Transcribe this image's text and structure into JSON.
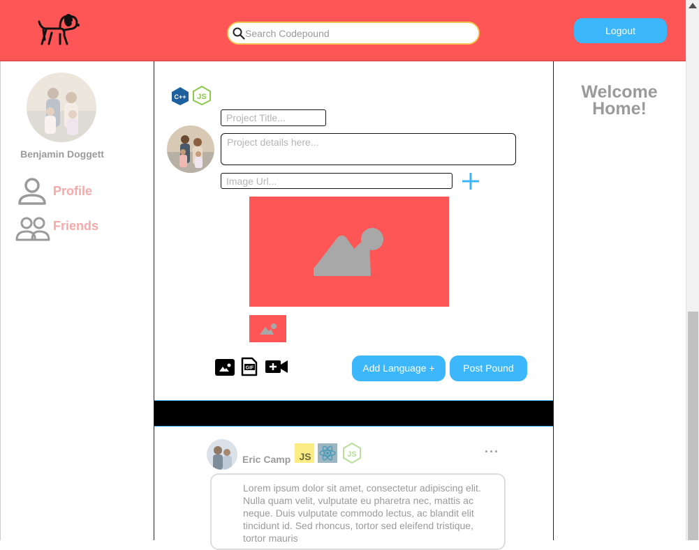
{
  "header": {
    "search_placeholder": "Search Codepound",
    "logout_label": "Logout"
  },
  "sidebar": {
    "username": "Benjamin Doggett",
    "items": [
      {
        "label": "Profile",
        "icon": "person-icon"
      },
      {
        "label": "Friends",
        "icon": "people-icon"
      }
    ]
  },
  "composer": {
    "languages": [
      "C++",
      "JS"
    ],
    "title_placeholder": "Project Title...",
    "details_placeholder": "Project details here...",
    "image_url_placeholder": "Image Url...",
    "add_language_label": "Add Language +",
    "post_label": "Post Pound",
    "media_icons": [
      "image-icon",
      "gif-icon",
      "video-add-icon"
    ]
  },
  "feed": {
    "post": {
      "author": "Eric Camp",
      "languages": [
        "JS",
        "React",
        "Node"
      ],
      "more_label": "···",
      "body": "Lorem ipsum dolor sit amet, consectetur adipiscing elit. Nulla quam velit, vulputate eu pharetra nec, mattis ac neque. Duis vulputate commodo lectus, ac blandit elit tincidunt id. Sed rhoncus, tortor sed eleifend tristique, tortor mauris"
    }
  },
  "right_panel": {
    "welcome_line1": "Welcome",
    "welcome_line2": "Home!"
  },
  "colors": {
    "header_bg": "#fe5656",
    "accent_blue": "#3db7fb",
    "search_border": "#f5c451",
    "muted_text": "#9a9a9a",
    "nav_text": "#f5a9a9"
  }
}
